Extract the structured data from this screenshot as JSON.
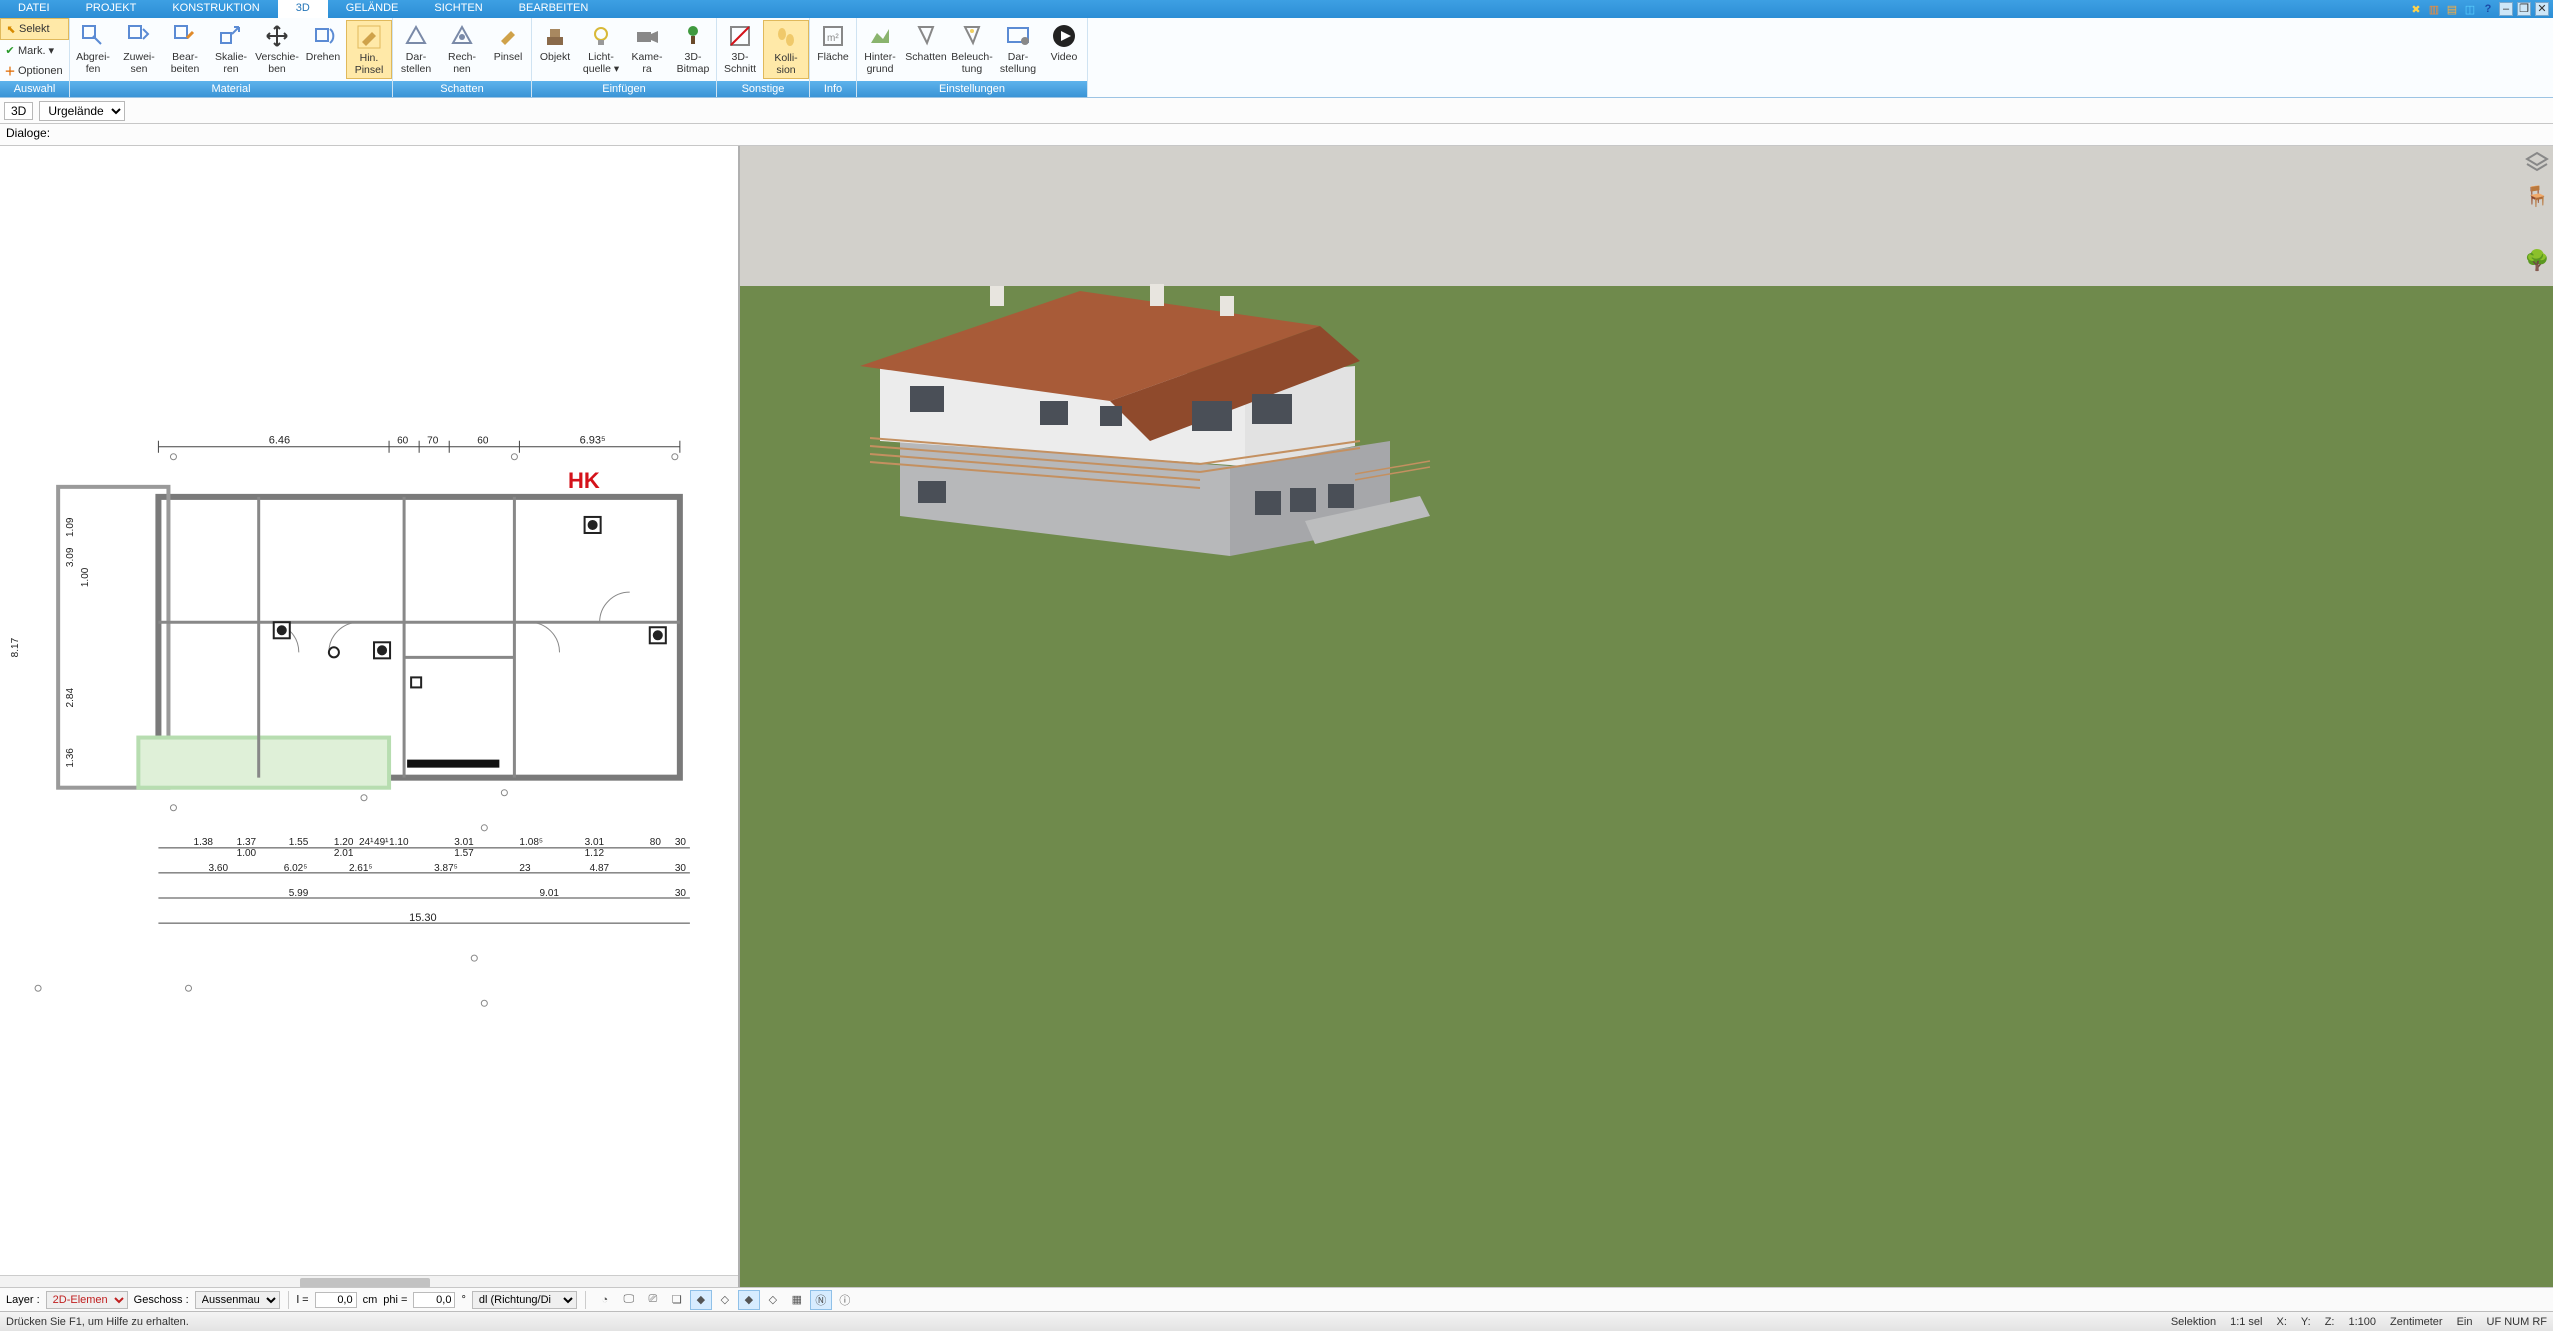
{
  "menu": {
    "tabs": [
      "DATEI",
      "PROJEKT",
      "KONSTRUKTION",
      "3D",
      "GELÄNDE",
      "SICHTEN",
      "BEARBEITEN"
    ],
    "active_index": 3
  },
  "titlebar_icons": [
    "tools-icon",
    "clipboard-icon",
    "preferences-icon",
    "window-icon",
    "help-icon"
  ],
  "window_buttons": [
    "–",
    "❐",
    "✕"
  ],
  "ribbon_left": {
    "rows": [
      {
        "glyph": "↖",
        "label": "Selekt"
      },
      {
        "glyph": "✔",
        "label": "Mark. ▾"
      },
      {
        "glyph": "＋",
        "label": "Optionen"
      }
    ],
    "group_label": "Auswahl"
  },
  "ribbon_groups": [
    {
      "label": "Material",
      "buttons": [
        {
          "id": "abgreifen",
          "label": "Abgrei-\nfen"
        },
        {
          "id": "zuweisen",
          "label": "Zuwei-\nsen"
        },
        {
          "id": "bearbeiten",
          "label": "Bear-\nbeiten"
        },
        {
          "id": "skalieren",
          "label": "Skalie-\nren"
        },
        {
          "id": "verschieben",
          "label": "Verschie-\nben"
        },
        {
          "id": "drehen",
          "label": "Drehen"
        },
        {
          "id": "hin-pinsel",
          "label": "Hin.\nPinsel",
          "active": true
        }
      ]
    },
    {
      "label": "Schatten",
      "buttons": [
        {
          "id": "darstellen",
          "label": "Dar-\nstellen"
        },
        {
          "id": "rechnen",
          "label": "Rech-\nnen"
        },
        {
          "id": "pinsel",
          "label": "Pinsel"
        }
      ]
    },
    {
      "label": "Einfügen",
      "buttons": [
        {
          "id": "objekt",
          "label": "Objekt"
        },
        {
          "id": "lichtquelle",
          "label": "Licht-\nquelle ▾"
        },
        {
          "id": "kamera",
          "label": "Kame-\nra"
        },
        {
          "id": "3d-bitmap",
          "label": "3D-\nBitmap"
        }
      ]
    },
    {
      "label": "Sonstige",
      "buttons": [
        {
          "id": "3d-schnitt",
          "label": "3D-\nSchnitt"
        },
        {
          "id": "kollision",
          "label": "Kolli-\nsion",
          "active": true
        }
      ]
    },
    {
      "label": "Info",
      "buttons": [
        {
          "id": "flaeche",
          "label": "Fläche"
        }
      ]
    },
    {
      "label": "Einstellungen",
      "buttons": [
        {
          "id": "hintergrund",
          "label": "Hinter-\ngrund"
        },
        {
          "id": "schatten2",
          "label": "Schatten"
        },
        {
          "id": "beleuchtung",
          "label": "Beleuch-\ntung"
        },
        {
          "id": "darstellung",
          "label": "Dar-\nstellung"
        },
        {
          "id": "video",
          "label": "Video"
        }
      ]
    }
  ],
  "subbar": {
    "mode": "3D",
    "layer_select": "Urgelände"
  },
  "dialogbar": {
    "label": "Dialoge:"
  },
  "plan_annotations": {
    "label_HK": "HK",
    "top_dims": [
      "6.46",
      "60",
      "70",
      "60",
      "6.93⁵"
    ],
    "left_dims": [
      "8.17",
      "3.09",
      "1.00",
      "2.84",
      "1.09",
      "1.36"
    ],
    "bottom_row1": [
      "1.38",
      "1.37",
      "1.55",
      "1.20",
      "24¹",
      "49¹",
      "1.10",
      "3.01",
      "1.08⁵",
      "3.01",
      "80",
      "30"
    ],
    "bottom_row1_sub": [
      "1.00",
      "2.01",
      "1.57",
      "1.12"
    ],
    "bottom_row2": [
      "3.60",
      "6.02⁵",
      "2.61⁵",
      "3.87⁵",
      "23",
      "4.87",
      "30"
    ],
    "bottom_row3": [
      "5.99",
      "9.01",
      "30"
    ],
    "bottom_total": "15.30"
  },
  "side_icons": [
    "layers-icon",
    "chair-icon",
    "palette-icon",
    "tree-icon"
  ],
  "toolbar2": {
    "layer_label": "Layer :",
    "layer_value": "2D-Elemen",
    "geschoss_label": "Geschoss :",
    "geschoss_value": "Aussenmau",
    "l_label": "l =",
    "l_value": "0,0",
    "l_unit": "cm",
    "phi_label": "phi =",
    "phi_value": "0,0",
    "phi_unit": "°",
    "dl_label": "dl (Richtung/Di",
    "iconbtns": [
      {
        "name": "clock-icon",
        "on": false
      },
      {
        "name": "monitor-icon",
        "on": false
      },
      {
        "name": "camera-icon",
        "on": false
      },
      {
        "name": "stack-icon",
        "on": false
      },
      {
        "name": "diamond1-icon",
        "on": true
      },
      {
        "name": "diamond2-icon",
        "on": false
      },
      {
        "name": "diamond3-icon",
        "on": true
      },
      {
        "name": "diamond4-icon",
        "on": false
      },
      {
        "name": "grid-icon",
        "on": false
      },
      {
        "name": "north-icon",
        "on": true
      },
      {
        "name": "info-icon",
        "on": false
      }
    ]
  },
  "statusbar": {
    "hint": "Drücken Sie F1, um Hilfe zu erhalten.",
    "selection": "Selektion",
    "sel_ratio": "1:1 sel",
    "x": "X:",
    "y": "Y:",
    "z": "Z:",
    "scale": "1:100",
    "unit": "Zentimeter",
    "ein": "Ein",
    "flags": "UF  NUM  RF"
  }
}
